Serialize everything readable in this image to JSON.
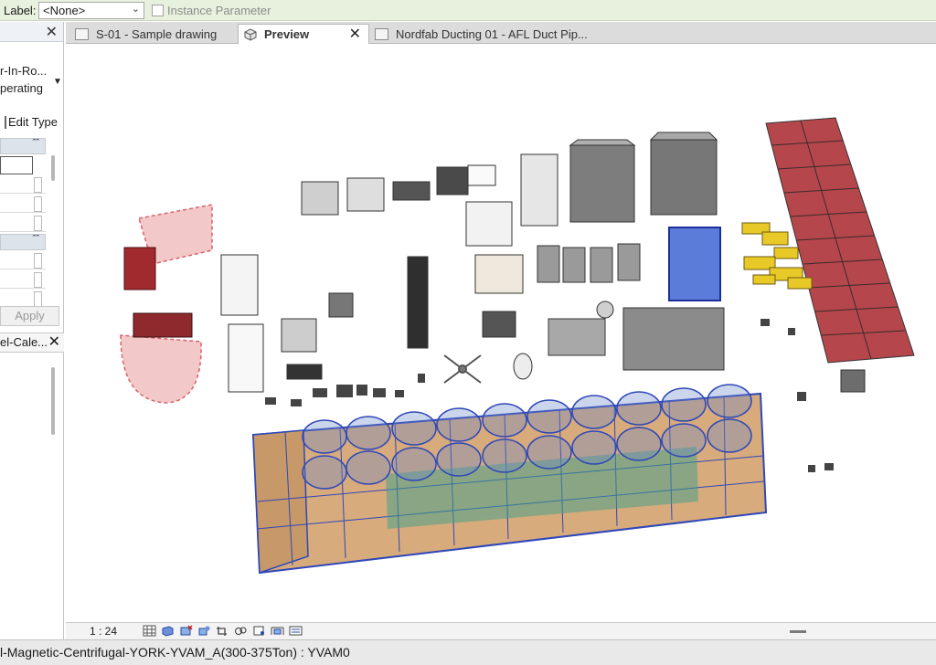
{
  "options_bar": {
    "label_caption": "Label:",
    "label_value": "<None>",
    "instance_parameter_label": "Instance Parameter"
  },
  "properties_panel": {
    "type_line1": "r-In-Ro...",
    "type_line2": "perating",
    "edit_type_label": "Edit Type",
    "apply_label": "Apply"
  },
  "project_browser": {
    "title": "el-Cale..."
  },
  "tabs": [
    {
      "label": "S-01 - Sample drawing",
      "active": false
    },
    {
      "label": "Preview",
      "active": true
    },
    {
      "label": "Nordfab Ducting 01 - AFL Duct Pip...",
      "active": false
    }
  ],
  "view_bar": {
    "scale": "1 : 24"
  },
  "status_bar": {
    "text": "l-Magnetic-Centrifugal-YORK-YVAM_A(300-375Ton) : YVAM0"
  },
  "colors": {
    "options_bar_bg": "#e8f1de",
    "selection_blue": "#2f48b8",
    "solar_panel": "#b5474c",
    "selection_red": "#d9616a",
    "tank_tan": "#d8ab7c"
  },
  "icons": [
    "close-icon",
    "chevron-down-icon",
    "document-icon",
    "cube-icon",
    "collapse-icon"
  ]
}
